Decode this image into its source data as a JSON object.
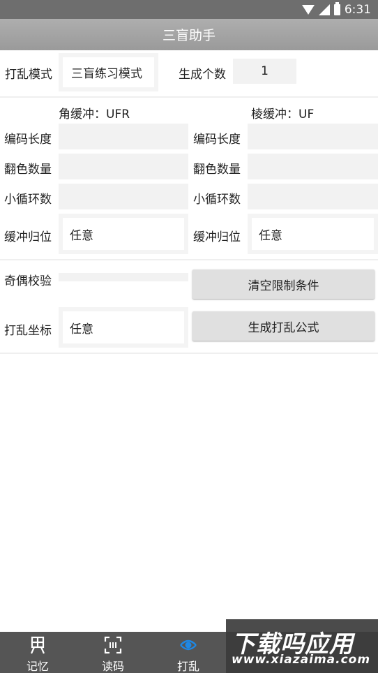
{
  "status_bar": {
    "time": "6:31"
  },
  "app_bar": {
    "title": "三盲助手"
  },
  "scramble_mode": {
    "label": "打乱模式",
    "value": "三盲练习模式"
  },
  "generate_count": {
    "label": "生成个数",
    "value": "1"
  },
  "corner": {
    "buffer_label": "角缓冲：UFR",
    "code_length_label": "编码长度",
    "flip_count_label": "翻色数量",
    "cycle_count_label": "小循环数",
    "buffer_return_label": "缓冲归位",
    "buffer_return_value": "任意"
  },
  "edge": {
    "buffer_label": "棱缓冲：UF",
    "code_length_label": "编码长度",
    "flip_count_label": "翻色数量",
    "cycle_count_label": "小循环数",
    "buffer_return_label": "缓冲归位",
    "buffer_return_value": "任意"
  },
  "parity_check": {
    "label": "奇偶校验"
  },
  "scramble_coord": {
    "label": "打乱坐标",
    "value": "任意"
  },
  "buttons": {
    "clear": "清空限制条件",
    "generate": "生成打乱公式"
  },
  "bottom_nav": [
    {
      "label": "记忆",
      "icon": "memory-icon"
    },
    {
      "label": "读码",
      "icon": "scan-code-icon"
    },
    {
      "label": "打乱",
      "icon": "scramble-icon"
    },
    {
      "label": "",
      "icon": "tab4-icon"
    },
    {
      "label": "",
      "icon": "tab5-icon"
    }
  ],
  "watermark": {
    "title": "下载吗应用",
    "url": "www.xiazaima.com"
  },
  "colors": {
    "accent": "#1e88e5",
    "app_bar": "#a4a4a4",
    "bottom_nav": "#555555"
  }
}
